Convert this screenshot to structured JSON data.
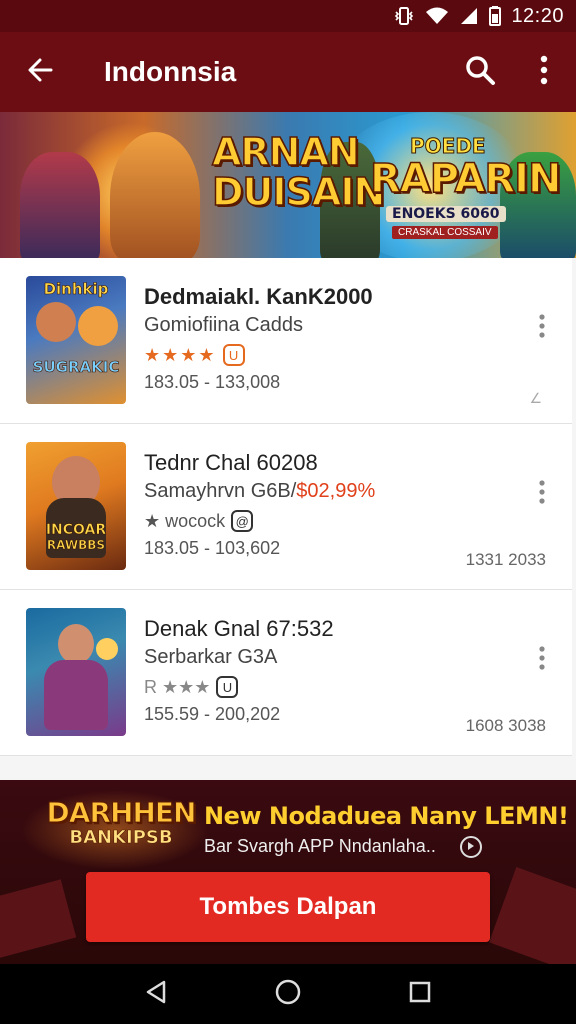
{
  "status_bar": {
    "time": "12:20"
  },
  "app_bar": {
    "title": "Indonnsia"
  },
  "hero": {
    "title_left_line1": "ARNAN",
    "title_left_line2": "DUISAIN",
    "title_right_small": "POEDE",
    "title_right_big": "RAPARIN",
    "title_right_tag": "ENOEKS 6060",
    "title_right_plate": "CRASKAL COSSAIV"
  },
  "list": {
    "items": [
      {
        "title": "Dedmaiakl. KanK2000",
        "subtitle": "Gomiofiina Cadds",
        "subtitle_price": "",
        "stars": 4,
        "stars_text": "★★★★",
        "rating_text": "",
        "badge_symbol": "U",
        "range": "183.05 - 133,008",
        "meta": "",
        "thumb_label_top": "Dinhkip",
        "thumb_label_bottom": "SUGRAKIC",
        "thumb_colors": [
          "#2a4a9a",
          "#e09030"
        ]
      },
      {
        "title": "Tednr Chal 60208",
        "subtitle": "Samayhrvn G6B/",
        "subtitle_price": "$02,99%",
        "stars": 0,
        "stars_text": "",
        "rating_text": "★ wocock",
        "badge_symbol": "@",
        "range": "183.05 - 103,602",
        "meta": "1331 2033",
        "thumb_label_top": "INCOAR",
        "thumb_label_bottom": "RAWBBS",
        "thumb_colors": [
          "#e07a20",
          "#6a2a10"
        ]
      },
      {
        "title": "Denak Gnal 67:532",
        "subtitle": "Serbarkar G3A",
        "subtitle_price": "",
        "stars": 0,
        "stars_text": "",
        "rating_text": "R ★★★",
        "badge_symbol": "U",
        "range": "155.59 - 200,202",
        "meta": "1608 3038",
        "thumb_label_top": "",
        "thumb_label_bottom": "",
        "thumb_colors": [
          "#1a6aa0",
          "#7a3a8a"
        ]
      }
    ]
  },
  "promo": {
    "logo_line1": "DARHHEN",
    "logo_line2": "BANKIPSB",
    "headline": "New Nodaduea Nany LEMN!",
    "subtext": "Bar Svargh APP Nndanlaha..",
    "cta_label": "Tombes Dalpan"
  },
  "colors": {
    "app_bar": "#6b0d12",
    "status_bar": "#5a0a0e",
    "accent_star": "#e56a20",
    "price": "#e0401a",
    "cta": "#e32a22",
    "promo_headline": "#ffcf30"
  },
  "icons": {
    "status": [
      "vibrate-icon",
      "wifi-icon",
      "signal-icon",
      "battery-icon"
    ],
    "app_bar": [
      "back-arrow-icon",
      "search-icon",
      "more-vert-icon"
    ],
    "nav": [
      "nav-back-icon",
      "nav-home-icon",
      "nav-recents-icon"
    ]
  }
}
